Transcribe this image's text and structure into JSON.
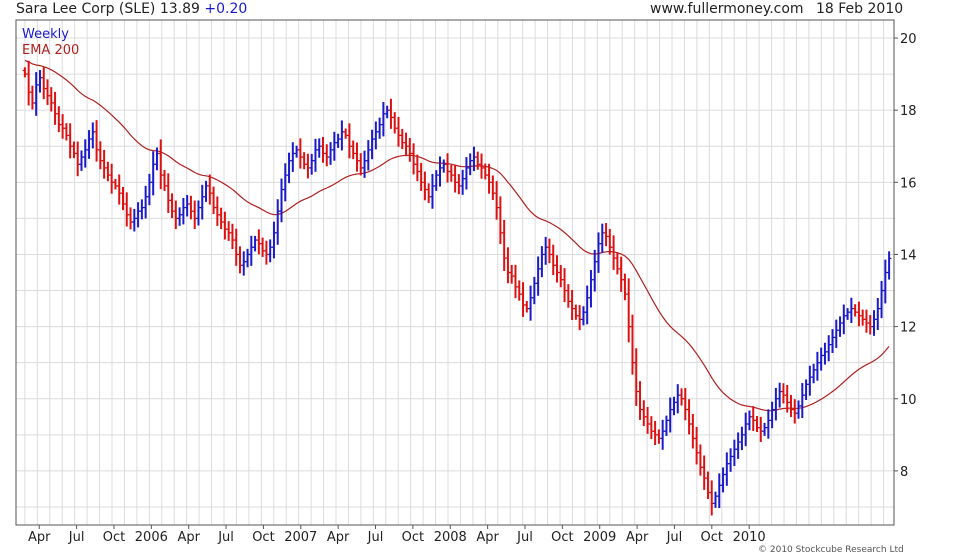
{
  "header": {
    "ticker": "Sara Lee Corp (SLE) 13.89",
    "change": "+0.20",
    "site": "www.fullermoney.com",
    "date": "18 Feb 2010"
  },
  "legend": {
    "frequency": "Weekly",
    "ema": "EMA 200"
  },
  "footer": {
    "copyright": "© 2010 Stockcube Research Ltd"
  },
  "colors": {
    "up": "#1a1acc",
    "down": "#dd1111",
    "ema": "#b02020",
    "grid": "#dcdcdc",
    "frame": "#555555"
  },
  "chart_data": {
    "type": "line",
    "subtype": "ohlc-weekly",
    "ylim": [
      6.5,
      20.5
    ],
    "yticks": [
      8,
      10,
      12,
      14,
      16,
      18,
      20
    ],
    "y_axis_side": "right",
    "grid": true,
    "legend_position": "top-left",
    "xlim": [
      0,
      302
    ],
    "x_tick_labels": [
      "Apr",
      "Jul",
      "Oct",
      "2006",
      "Apr",
      "Jul",
      "Oct",
      "2007",
      "Apr",
      "Jul",
      "Oct",
      "2008",
      "Apr",
      "Jul",
      "Oct",
      "2009",
      "Apr",
      "Jul",
      "Oct",
      "2010"
    ],
    "x_tick_weeks": [
      6,
      19,
      32,
      45,
      58,
      71,
      84,
      97,
      110,
      123,
      136,
      149,
      162,
      175,
      188,
      201,
      214,
      227,
      240,
      253
    ],
    "close": [
      19.0,
      18.5,
      18.2,
      18.7,
      18.9,
      18.6,
      18.4,
      18.2,
      17.9,
      17.6,
      17.5,
      17.3,
      17.0,
      16.8,
      16.5,
      16.7,
      16.9,
      17.2,
      17.4,
      16.9,
      16.6,
      16.4,
      16.2,
      16.0,
      15.9,
      15.7,
      15.4,
      15.1,
      14.9,
      15.0,
      15.2,
      15.3,
      15.6,
      16.0,
      16.5,
      16.8,
      16.2,
      15.9,
      15.5,
      15.2,
      15.0,
      15.1,
      15.3,
      15.4,
      15.2,
      15.0,
      15.3,
      15.6,
      15.9,
      15.7,
      15.3,
      15.1,
      14.9,
      14.7,
      14.6,
      14.4,
      14.0,
      13.7,
      13.8,
      14.0,
      14.2,
      14.4,
      14.3,
      14.1,
      14.0,
      14.2,
      14.6,
      15.2,
      15.8,
      16.2,
      16.6,
      16.8,
      16.9,
      16.7,
      16.5,
      16.4,
      16.6,
      16.9,
      17.0,
      16.8,
      16.7,
      16.9,
      17.1,
      17.2,
      17.4,
      17.3,
      17.0,
      16.8,
      16.6,
      16.4,
      16.6,
      16.9,
      17.2,
      17.4,
      17.6,
      17.9,
      18.0,
      17.8,
      17.5,
      17.3,
      17.1,
      17.0,
      16.8,
      16.5,
      16.3,
      16.0,
      15.8,
      15.6,
      15.9,
      16.2,
      16.4,
      16.5,
      16.3,
      16.2,
      16.0,
      15.9,
      16.1,
      16.4,
      16.6,
      16.7,
      16.5,
      16.4,
      16.2,
      16.0,
      15.7,
      15.3,
      14.6,
      13.9,
      13.5,
      13.4,
      13.1,
      12.9,
      12.6,
      12.5,
      12.8,
      13.2,
      13.6,
      14.0,
      14.2,
      14.0,
      13.7,
      13.5,
      13.3,
      13.0,
      12.7,
      12.5,
      12.3,
      12.2,
      12.4,
      12.8,
      13.3,
      13.8,
      14.3,
      14.6,
      14.5,
      14.2,
      13.9,
      13.6,
      13.3,
      12.9,
      12.0,
      11.0,
      10.2,
      9.7,
      9.5,
      9.3,
      9.1,
      9.0,
      8.9,
      9.1,
      9.4,
      9.7,
      9.9,
      10.1,
      10.0,
      9.7,
      9.3,
      8.9,
      8.5,
      8.1,
      7.8,
      7.4,
      7.1,
      7.3,
      7.6,
      7.9,
      8.2,
      8.4,
      8.6,
      8.8,
      9.0,
      9.3,
      9.5,
      9.4,
      9.2,
      9.1,
      9.2,
      9.4,
      9.7,
      10.0,
      10.2,
      10.1,
      9.9,
      9.7,
      9.6,
      9.8,
      10.1,
      10.4,
      10.6,
      10.8,
      11.0,
      11.2,
      11.3,
      11.5,
      11.7,
      11.9,
      12.1,
      12.3,
      12.4,
      12.5,
      12.4,
      12.3,
      12.2,
      12.1,
      12.0,
      12.2,
      12.5,
      13.0,
      13.5,
      13.89
    ]
  }
}
